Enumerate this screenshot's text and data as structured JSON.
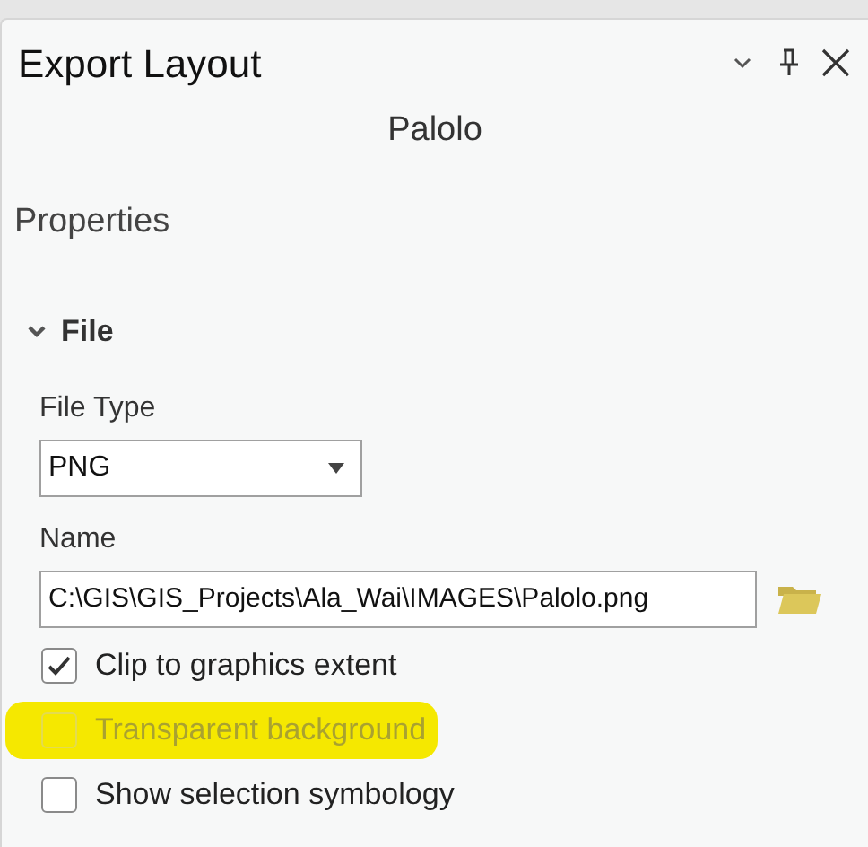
{
  "pane": {
    "title": "Export Layout",
    "subtitle": "Palolo",
    "section": "Properties"
  },
  "group": {
    "label": "File",
    "expanded": true
  },
  "file_type": {
    "label": "File Type",
    "value": "PNG"
  },
  "name": {
    "label": "Name",
    "value": "C:\\GIS\\GIS_Projects\\Ala_Wai\\IMAGES\\Palolo.png"
  },
  "options": [
    {
      "label": "Clip to graphics extent",
      "checked": true,
      "disabled": false,
      "highlighted": false
    },
    {
      "label": "Transparent background",
      "checked": false,
      "disabled": true,
      "highlighted": true
    },
    {
      "label": "Show selection symbology",
      "checked": false,
      "disabled": false,
      "highlighted": false
    }
  ]
}
